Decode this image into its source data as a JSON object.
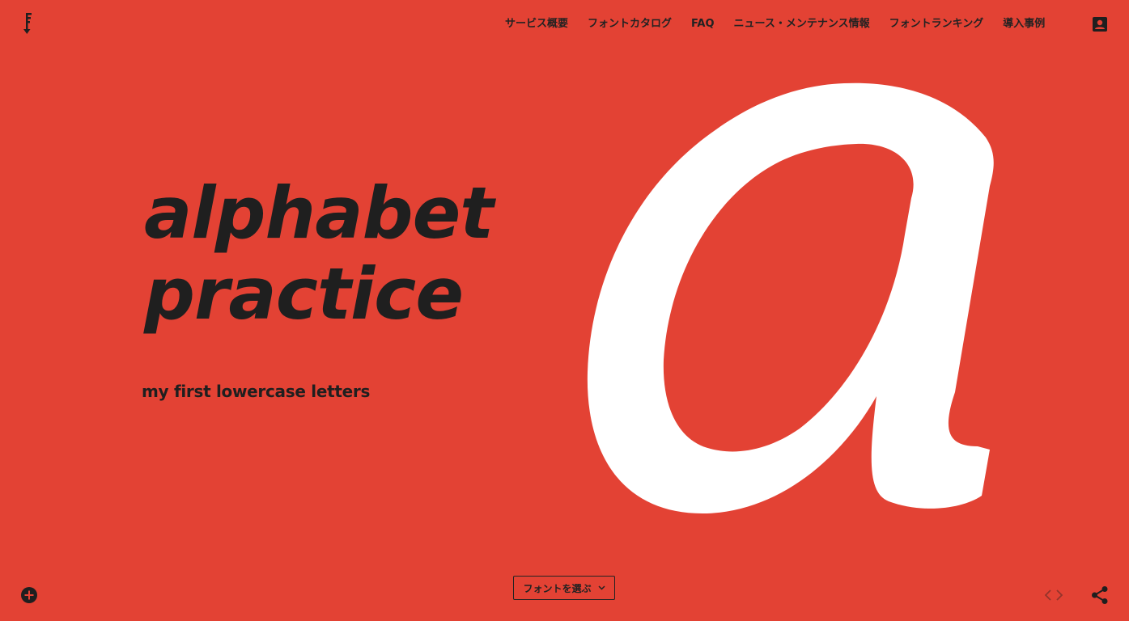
{
  "nav": {
    "items": [
      {
        "label": "サービス概要"
      },
      {
        "label": "フォントカタログ"
      },
      {
        "label": "FAQ"
      },
      {
        "label": "ニュース・メンテナンス情報"
      },
      {
        "label": "フォントランキング"
      },
      {
        "label": "導入事例"
      }
    ]
  },
  "hero": {
    "line1": "alphabet",
    "line2": "practice",
    "subtitle": "my first lowercase letters",
    "glyph": "a"
  },
  "controls": {
    "font_select_label": "フォントを選ぶ"
  },
  "colors": {
    "background": "#e34234",
    "text": "#1f1f1f",
    "glyph": "#ffffff"
  },
  "icons": {
    "logo": "logo-icon",
    "account": "account-icon",
    "add": "plus-circle-icon",
    "dropdown": "chevron-down-icon",
    "code": "code-icon",
    "share": "share-icon"
  }
}
